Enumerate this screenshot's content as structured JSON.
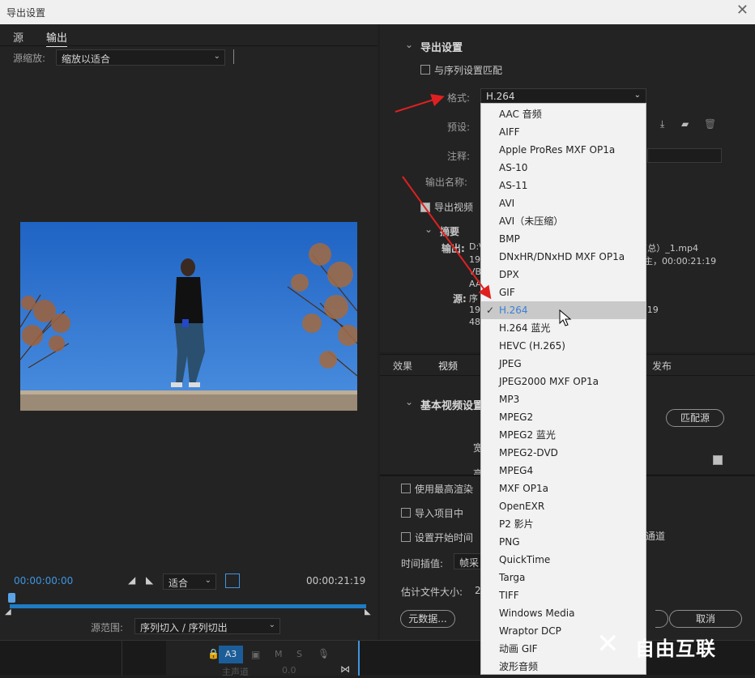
{
  "window": {
    "title": "导出设置",
    "close_glyph": "✕"
  },
  "left_tabs": [
    "源",
    "输出"
  ],
  "source_zoom": {
    "label": "源缩放:",
    "value": "缩放以适合"
  },
  "timeline": {
    "start": "00:00:00:00",
    "end": "00:00:21:19",
    "fit": "适合",
    "range_label": "源范围:",
    "range_value": "序列切入 / 序列切出",
    "progress": 0
  },
  "export": {
    "section": "导出设置",
    "match_seq": "与序列设置匹配",
    "format_label": "格式:",
    "format_value": "H.264",
    "preset_label": "预设:",
    "comment_label": "注释:",
    "output_name_label": "输出名称:",
    "export_video": "导出视频",
    "summary": "摘要",
    "output_label": "输出:",
    "output_lines": [
      "D:\\",
      "192",
      "VB",
      "AA"
    ],
    "output_right": [
      "(总）_1.mp4",
      "主，00:00:21:19"
    ],
    "source_label": "源:",
    "source_lines": [
      "序",
      "192",
      "480"
    ],
    "source_right": [
      ":19"
    ]
  },
  "tabs2": [
    "效果",
    "视频",
    "发布"
  ],
  "video": {
    "section": "基本视频设置",
    "match_source": "匹配源",
    "w_label": "宽",
    "h_label": "高"
  },
  "bottom": {
    "max_render": "使用最高渲染",
    "import_project": "导入项目中",
    "set_start": "设置开始时间",
    "channel": "通道",
    "interp_label": "时间插值:",
    "interp_value": "帧采",
    "filesize_label": "估计文件大小:",
    "filesize_value": "2",
    "metadata_btn": "元数据...",
    "cancel_btn": "取消"
  },
  "bottom_strip": {
    "track": "A3",
    "m": "M",
    "s": "S",
    "track_name": "主声道",
    "vol": "0.0"
  },
  "dropdown": {
    "selected_index": 11,
    "options": [
      "AAC 音频",
      "AIFF",
      "Apple ProRes MXF OP1a",
      "AS-10",
      "AS-11",
      "AVI",
      "AVI（未压缩）",
      "BMP",
      "DNxHR/DNxHD MXF OP1a",
      "DPX",
      "GIF",
      "H.264",
      "H.264 蓝光",
      "HEVC (H.265)",
      "JPEG",
      "JPEG2000 MXF OP1a",
      "MP3",
      "MPEG2",
      "MPEG2 蓝光",
      "MPEG2-DVD",
      "MPEG4",
      "MXF OP1a",
      "OpenEXR",
      "P2 影片",
      "PNG",
      "QuickTime",
      "Targa",
      "TIFF",
      "Windows Media",
      "Wraptor DCP",
      "动画 GIF",
      "波形音频"
    ]
  },
  "colors": {
    "accent": "#1e7cc4",
    "selected_text": "#3b80d6",
    "arrow": "#e02020"
  },
  "watermark": "自由互联"
}
